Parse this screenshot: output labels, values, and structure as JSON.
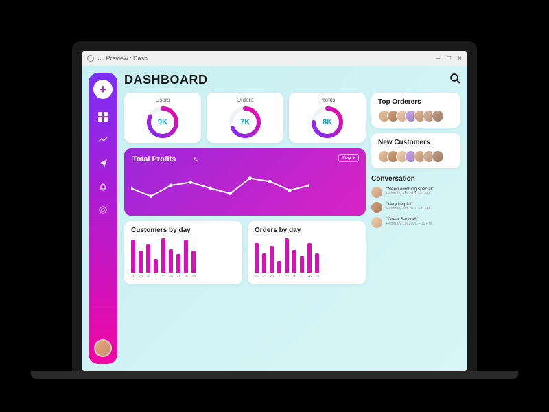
{
  "window": {
    "title": "Preview : Dash"
  },
  "header": {
    "title": "DASHBOARD"
  },
  "sidebar": {
    "add_label": "+",
    "items": [
      "grid",
      "trend",
      "send",
      "bell",
      "gear"
    ]
  },
  "stats": [
    {
      "label": "Users",
      "value": "9K",
      "fill": 0.82
    },
    {
      "label": "Orders",
      "value": "7K",
      "fill": 0.68
    },
    {
      "label": "Profits",
      "value": "8K",
      "fill": 0.75
    }
  ],
  "profits_chart": {
    "title": "Total Profits",
    "dropdown": "Day ▾",
    "type": "line",
    "x": [
      0,
      1,
      2,
      3,
      4,
      5,
      6,
      7,
      8,
      9
    ],
    "values": [
      0.55,
      0.35,
      0.62,
      0.7,
      0.55,
      0.42,
      0.8,
      0.72,
      0.5,
      0.62
    ]
  },
  "chart_data": [
    {
      "type": "bar",
      "title": "Customers by day",
      "categories": [
        "26",
        "23",
        "28",
        "7",
        "33",
        "26",
        "21",
        "26",
        "23"
      ],
      "values": [
        42,
        28,
        36,
        18,
        44,
        30,
        24,
        42,
        28
      ]
    },
    {
      "type": "bar",
      "title": "Orders by day",
      "categories": [
        "26",
        "23",
        "28",
        "7",
        "33",
        "26",
        "21",
        "26",
        "23"
      ],
      "values": [
        40,
        26,
        36,
        16,
        46,
        30,
        22,
        40,
        26
      ]
    }
  ],
  "right": {
    "top_orderers": {
      "title": "Top Orderers",
      "count": 7
    },
    "new_customers": {
      "title": "New Customers",
      "count": 7
    },
    "conversation": {
      "title": "Conversation",
      "items": [
        {
          "msg": "\"Need anything special\"",
          "date": "February 4th 2020 – 9 AM"
        },
        {
          "msg": "\"Very helpful\"",
          "date": "February 4th 2020 – 8 AM"
        },
        {
          "msg": "\"Great Service!\"",
          "date": "February 1st 2020 – 11 PM"
        }
      ]
    }
  }
}
